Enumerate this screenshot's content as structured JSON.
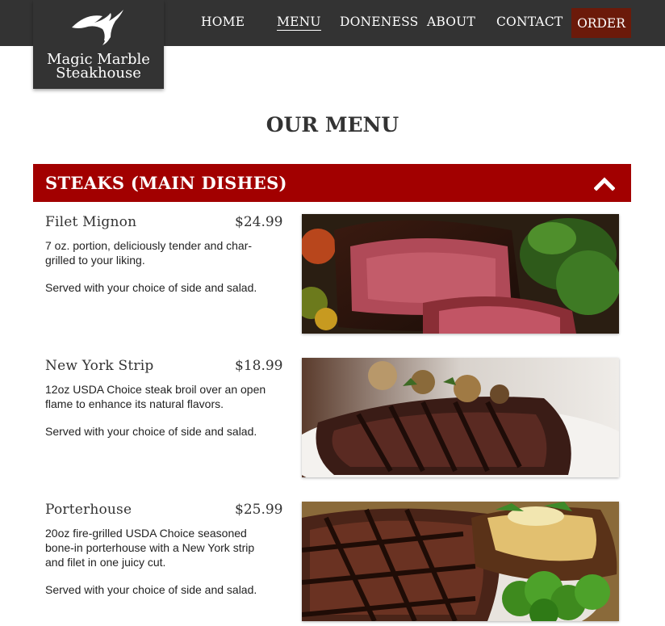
{
  "brand": {
    "line1": "Magic Marble",
    "line2": "Steakhouse"
  },
  "nav": {
    "items": [
      "HOME",
      "MENU",
      "DONENESS",
      "ABOUT",
      "CONTACT"
    ],
    "active": "MENU",
    "order_label": "ORDER"
  },
  "colors": {
    "header_bg": "#333333",
    "section_bar": "#a20000",
    "order_button": "#6b1a0a"
  },
  "page_title": "OUR MENU",
  "section": {
    "title": "STEAKS (MAIN DISHES)",
    "toggle_icon": "chevron-up-icon"
  },
  "menu_items": [
    {
      "name": "Filet Mignon",
      "price": "$24.99",
      "desc": "7 oz. portion, deliciously tender and char-grilled to your liking.",
      "served": "Served with your choice of side and salad.",
      "image": "filet-mignon-photo"
    },
    {
      "name": "New York Strip",
      "price": "$18.99",
      "desc": "12oz USDA Choice steak broil over an open flame to enhance its natural flavors.",
      "served": "Served with your choice of side and salad.",
      "image": "new-york-strip-photo"
    },
    {
      "name": "Porterhouse",
      "price": "$25.99",
      "desc": "20oz fire-grilled USDA Choice seasoned bone-in porterhouse with a New York strip and filet in one juicy cut.",
      "served": "Served with your choice of side and salad.",
      "image": "porterhouse-photo"
    }
  ]
}
